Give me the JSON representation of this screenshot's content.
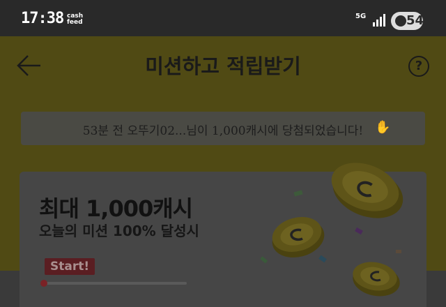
{
  "status_bar": {
    "time": "17:38",
    "brand_line1": "cash",
    "brand_line2": "feed",
    "network": "5G",
    "battery": "54"
  },
  "header": {
    "title": "미션하고 적립받기",
    "help_symbol": "?"
  },
  "notice": {
    "text": "53분 전 오뚜기02...님이 1,000캐시에 당첨되었습니다!"
  },
  "promo": {
    "headline": "최대 1,000캐시",
    "subtitle": "오늘의 미션 100% 달성시",
    "start_label": "Start!",
    "progress": 0
  },
  "colors": {
    "accent_yellow": "#504a14",
    "start_red": "#5a1e22"
  }
}
